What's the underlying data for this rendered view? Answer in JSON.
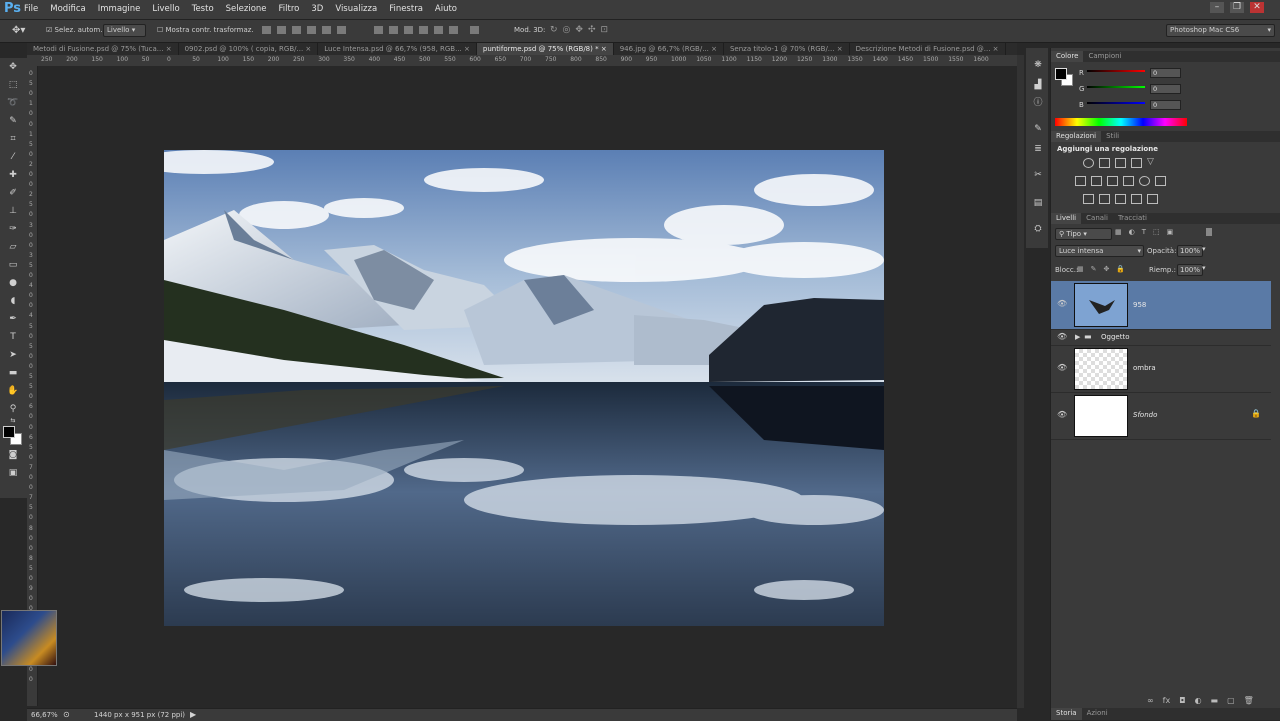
{
  "app": {
    "logo": "Ps",
    "workspace": "Photoshop Mac CS6"
  },
  "menu": [
    "File",
    "Modifica",
    "Immagine",
    "Livello",
    "Testo",
    "Selezione",
    "Filtro",
    "3D",
    "Visualizza",
    "Finestra",
    "Aiuto"
  ],
  "options": {
    "autoselect_label": "Selez. autom.",
    "autoselect_value": "Livello",
    "transform_label": "Mostra contr. trasformaz.",
    "mode3d_label": "Mod. 3D:"
  },
  "tabs": [
    {
      "label": "Metodi di Fusione.psd @ 75% (Tuca...",
      "active": false
    },
    {
      "label": "0902.psd @ 100% ( copia, RGB/...",
      "active": false
    },
    {
      "label": "Luce Intensa.psd @ 66,7% (958, RGB...",
      "active": false
    },
    {
      "label": "puntiforme.psd @ 75% (RGB/8) *",
      "active": true
    },
    {
      "label": "946.jpg @ 66,7% (RGB/...",
      "active": false
    },
    {
      "label": "Senza titolo-1 @ 70% (RGB/...",
      "active": false
    },
    {
      "label": "Descrizione Metodi di Fusione.psd @...",
      "active": false
    }
  ],
  "ruler_h": [
    "250",
    "200",
    "150",
    "100",
    "50",
    "0",
    "50",
    "100",
    "150",
    "200",
    "250",
    "300",
    "350",
    "400",
    "450",
    "500",
    "550",
    "600",
    "650",
    "700",
    "750",
    "800",
    "850",
    "900",
    "950",
    "1000",
    "1050",
    "1100",
    "1150",
    "1200",
    "1250",
    "1300",
    "1350",
    "1400",
    "1450",
    "1500",
    "1550",
    "1600"
  ],
  "ruler_v": [
    "0",
    "5",
    "0",
    "1",
    "0",
    "0",
    "1",
    "5",
    "0",
    "2",
    "0",
    "0",
    "2",
    "5",
    "0",
    "3",
    "0",
    "0",
    "3",
    "5",
    "0",
    "4",
    "0",
    "0",
    "4",
    "5",
    "0",
    "5",
    "0",
    "0",
    "5",
    "5",
    "0",
    "6",
    "0",
    "0",
    "6",
    "5",
    "0",
    "7",
    "0",
    "0",
    "7",
    "5",
    "0",
    "8",
    "0",
    "0",
    "8",
    "5",
    "0",
    "9",
    "0",
    "0",
    "9",
    "5",
    "0",
    "1",
    "0",
    "0",
    "0"
  ],
  "status": {
    "zoom": "66,67%",
    "doc_size": "1440 px x 951 px (72 ppi)"
  },
  "color_panel": {
    "tabs": [
      "Colore",
      "Campioni"
    ],
    "r": {
      "label": "R",
      "value": "0"
    },
    "g": {
      "label": "G",
      "value": "0"
    },
    "b": {
      "label": "B",
      "value": "0"
    }
  },
  "adjust_panel": {
    "tabs": [
      "Regolazioni",
      "Stili"
    ],
    "title": "Aggiungi una regolazione"
  },
  "layers_panel": {
    "tabs": [
      "Livelli",
      "Canali",
      "Tracciati"
    ],
    "filter": "Tipo",
    "blend": "Luce intensa",
    "opacity_label": "Opacità:",
    "opacity": "100%",
    "lock_label": "Blocc.:",
    "fill_label": "Riemp.:",
    "fill": "100%",
    "layers": [
      {
        "name": "958",
        "selected": true
      },
      {
        "name": "Oggetto",
        "group": true
      },
      {
        "name": "ombra"
      },
      {
        "name": "Sfondo",
        "locked": true
      }
    ]
  },
  "bottom_tabs": [
    "Storia",
    "Azioni"
  ],
  "colors": {
    "accent": "#5ab0f0",
    "selected_layer": "#5a7aa6",
    "panel": "#3a3a3a",
    "canvas": "#282828"
  }
}
